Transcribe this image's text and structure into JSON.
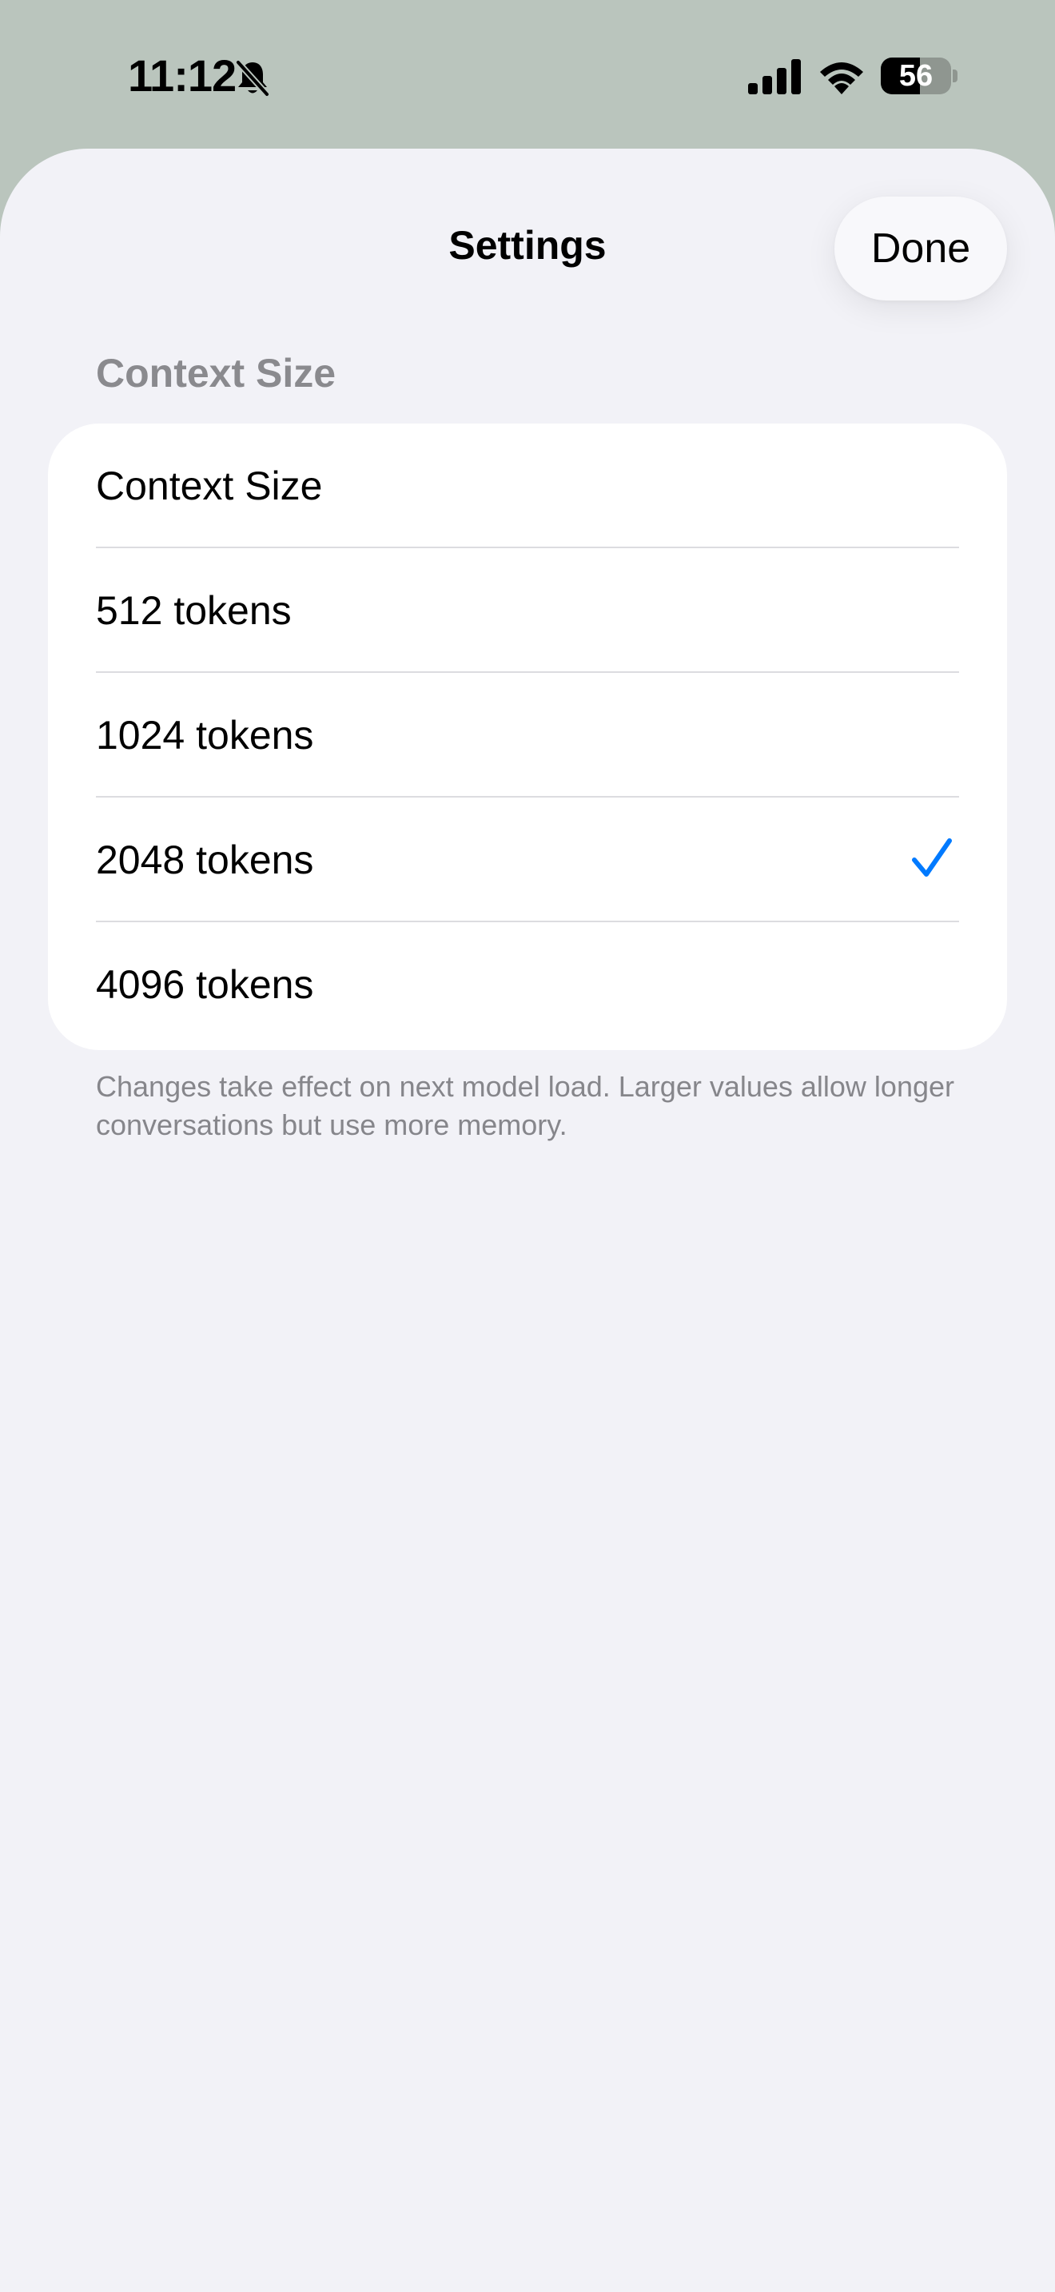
{
  "status_bar": {
    "time": "11:12",
    "battery_level": "56",
    "battery_fraction": 0.56,
    "icons": [
      "bell-slash-icon",
      "cellular-signal-icon",
      "wifi-icon",
      "battery-icon"
    ]
  },
  "sheet": {
    "title": "Settings",
    "done_label": "Done"
  },
  "context_section": {
    "header": "Context Size",
    "picker_label": "Context Size",
    "options": [
      {
        "label": "512 tokens",
        "selected": false
      },
      {
        "label": "1024 tokens",
        "selected": false
      },
      {
        "label": "2048 tokens",
        "selected": true
      },
      {
        "label": "4096 tokens",
        "selected": false
      }
    ],
    "footer": "Changes take effect on next model load. Larger values allow longer conversations but use more memory."
  },
  "colors": {
    "accent": "#007aff",
    "sheet_background": "#f2f2f7",
    "group_background": "#ffffff",
    "status_background": "#bac5bd",
    "secondary_text": "#8a8a8e"
  }
}
